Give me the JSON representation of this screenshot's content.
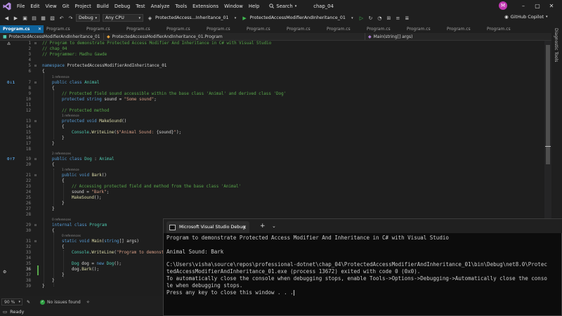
{
  "menu": {
    "items": [
      "File",
      "Edit",
      "View",
      "Git",
      "Project",
      "Build",
      "Debug",
      "Test",
      "Analyze",
      "Tools",
      "Extensions",
      "Window",
      "Help"
    ],
    "search_label": "Search",
    "solution_name": "chap_04",
    "avatar_letter": "M"
  },
  "toolbar": {
    "configuration": "Debug",
    "platform": "Any CPU",
    "startup_project": "ProtectedAccess...Inheritance_01",
    "run_target": "ProtectedAccessModifierAndInheritance_01",
    "copilot": "GitHub Copilot"
  },
  "tabs": [
    "Program.cs",
    "Program.cs",
    "Program.cs",
    "Program.cs",
    "Program.cs",
    "Program.cs",
    "Program.cs",
    "Program.cs",
    "Program.cs",
    "Program.cs",
    "Program.cs",
    "Program.cs",
    "Program.cs"
  ],
  "navbar": {
    "project": "ProtectedAccessModifierAndInheritance_01",
    "class": "ProtectedAccessModifierAndInheritance_01.Program",
    "member": "Main(string[] args)"
  },
  "refs": {
    "r1": "1 reference",
    "r2": "1 reference",
    "r3": "2 references",
    "r4": "1 reference",
    "r5": "0 references",
    "r6": "0 references"
  },
  "gutter_markers": {
    "m7": "0↓1",
    "m19": "0↑7"
  },
  "code_lines": [
    "// Program to demonstrate Protected Access Modifier And Inheritance in C# with Visual Studio",
    "// chap_04",
    "// Programmer: Madhu Gawde",
    "",
    "namespace ProtectedAccessModifierAndInheritance_01",
    "{",
    "public class Animal",
    "{",
    "// Protected field sound accessible within the base class 'Animal' and derived class 'Dog'",
    "protected string sound = \"Some sound\";",
    "",
    "// Protected method",
    "protected void MakeSound()",
    "{",
    "Console.WriteLine($\"Animal Sound: {sound}\");",
    "}",
    "}",
    "",
    "public class Dog : Animal",
    "{",
    "public void Bark()",
    "{",
    "// Accessing protected field and method from the base class 'Animal'",
    "sound = \"Bark\";",
    "MakeSound();",
    "}",
    "}",
    "",
    "internal class Program",
    "{",
    "static void Main(string[] args)",
    "{",
    "Console.WriteLine(\"Program to demonstr",
    "",
    "Dog dog = new Dog();",
    "dog.Bark();",
    "}",
    "}"
  ],
  "editor_status": {
    "zoom": "90 %",
    "issues": "No issues found"
  },
  "status_bar": {
    "text": "Ready"
  },
  "console": {
    "title": "Microsoft Visual Studio Debug",
    "lines": [
      "Program to demonstrate Protected Access Modifier And Inheritance in C# with Visual Studio",
      "",
      "Animal Sound: Bark",
      "",
      "C:\\Users\\visha\\source\\repos\\professional-dotnet\\chap_04\\ProtectedAccessModifierAndInheritance_01\\bin\\Debug\\net8.0\\Protec",
      "tedAccessModifierAndInheritance_01.exe (process 13672) exited with code 0 (0x0).",
      "To automatically close the console when debugging stops, enable Tools->Options->Debugging->Automatically close the conso",
      "le when debugging stops.",
      "Press any key to close this window . . ."
    ]
  },
  "right_panel": {
    "label": "Diagnostic Tools"
  },
  "colors": {
    "keyword": "#569cd6",
    "type": "#4ec9b0",
    "comment": "#57a64a",
    "string": "#d69d85",
    "method": "#dcdcaa",
    "active_tab": "#0e639c"
  }
}
